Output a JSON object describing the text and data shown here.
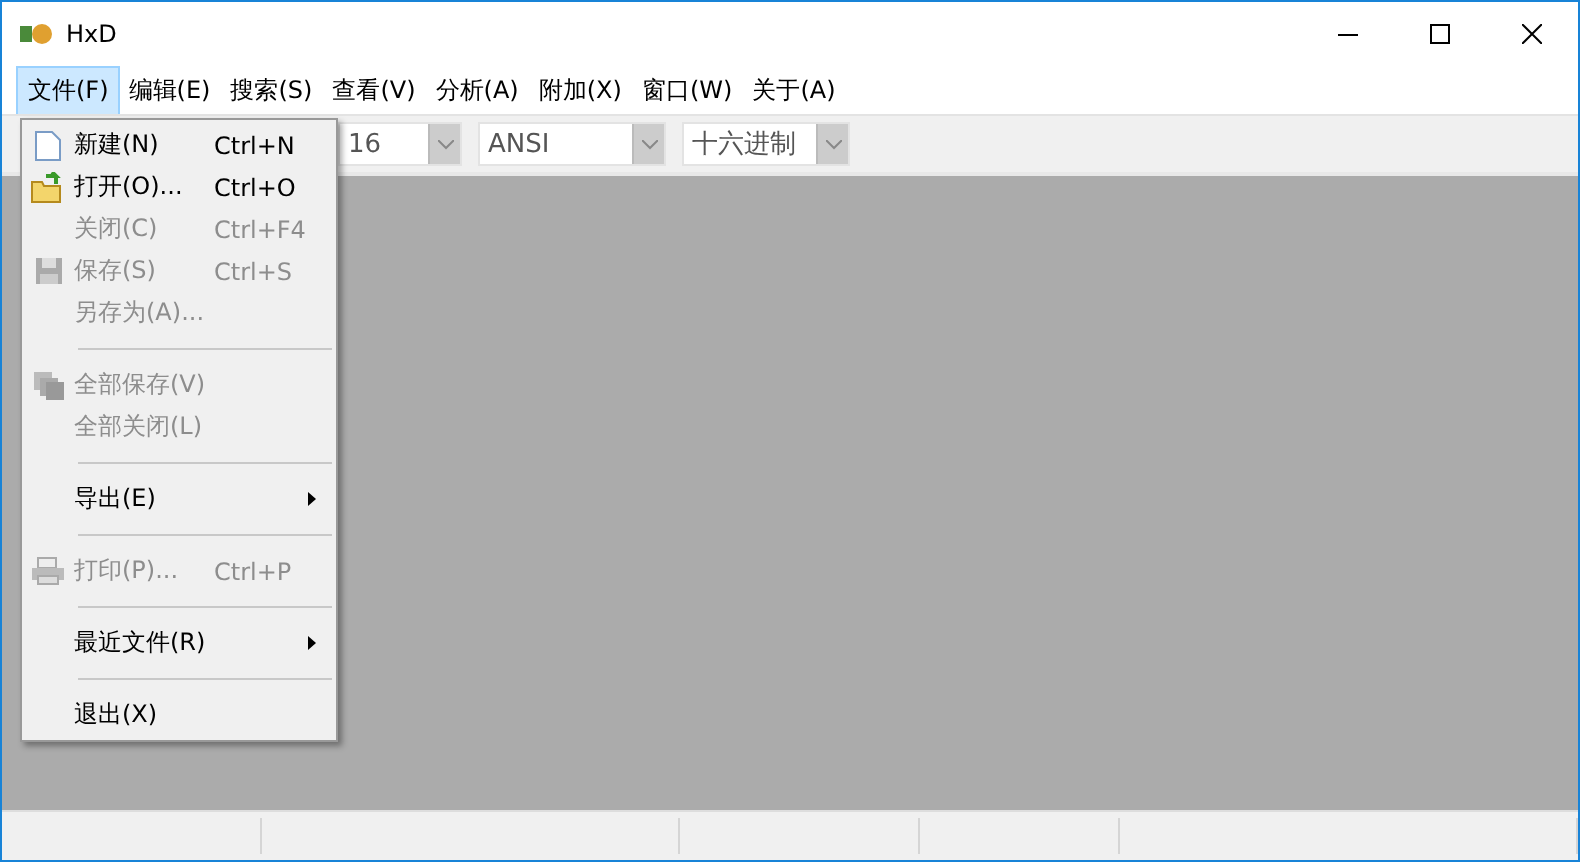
{
  "window": {
    "title": "HxD"
  },
  "menu_bar": [
    {
      "label": "文件(F)",
      "selected": true
    },
    {
      "label": "编辑(E)",
      "selected": false
    },
    {
      "label": "搜索(S)",
      "selected": false
    },
    {
      "label": "查看(V)",
      "selected": false
    },
    {
      "label": "分析(A)",
      "selected": false
    },
    {
      "label": "附加(X)",
      "selected": false
    },
    {
      "label": "窗口(W)",
      "selected": false
    },
    {
      "label": "关于(A)",
      "selected": false
    }
  ],
  "toolbar": {
    "combos": [
      {
        "value": "16"
      },
      {
        "value": "ANSI"
      },
      {
        "value": "十六进制"
      }
    ]
  },
  "file_menu": [
    {
      "kind": "item",
      "label": "新建(N)",
      "shortcut": "Ctrl+N",
      "disabled": false,
      "has_submenu": false
    },
    {
      "kind": "item",
      "label": "打开(O)...",
      "shortcut": "Ctrl+O",
      "disabled": false,
      "has_submenu": false
    },
    {
      "kind": "item",
      "label": "关闭(C)",
      "shortcut": "Ctrl+F4",
      "disabled": true,
      "has_submenu": false
    },
    {
      "kind": "item",
      "label": "保存(S)",
      "shortcut": "Ctrl+S",
      "disabled": true,
      "has_submenu": false
    },
    {
      "kind": "item",
      "label": "另存为(A)...",
      "disabled": true,
      "has_submenu": false
    },
    {
      "kind": "separator"
    },
    {
      "kind": "item",
      "label": "全部保存(V)",
      "disabled": true,
      "has_submenu": false
    },
    {
      "kind": "item",
      "label": "全部关闭(L)",
      "disabled": true,
      "has_submenu": false
    },
    {
      "kind": "separator"
    },
    {
      "kind": "item",
      "label": "导出(E)",
      "disabled": false,
      "has_submenu": true
    },
    {
      "kind": "separator"
    },
    {
      "kind": "item",
      "label": "打印(P)...",
      "shortcut": "Ctrl+P",
      "disabled": true,
      "has_submenu": false
    },
    {
      "kind": "separator"
    },
    {
      "kind": "item",
      "label": "最近文件(R)",
      "disabled": false,
      "has_submenu": true
    },
    {
      "kind": "separator"
    },
    {
      "kind": "item",
      "label": "退出(X)",
      "disabled": false,
      "has_submenu": false
    }
  ]
}
